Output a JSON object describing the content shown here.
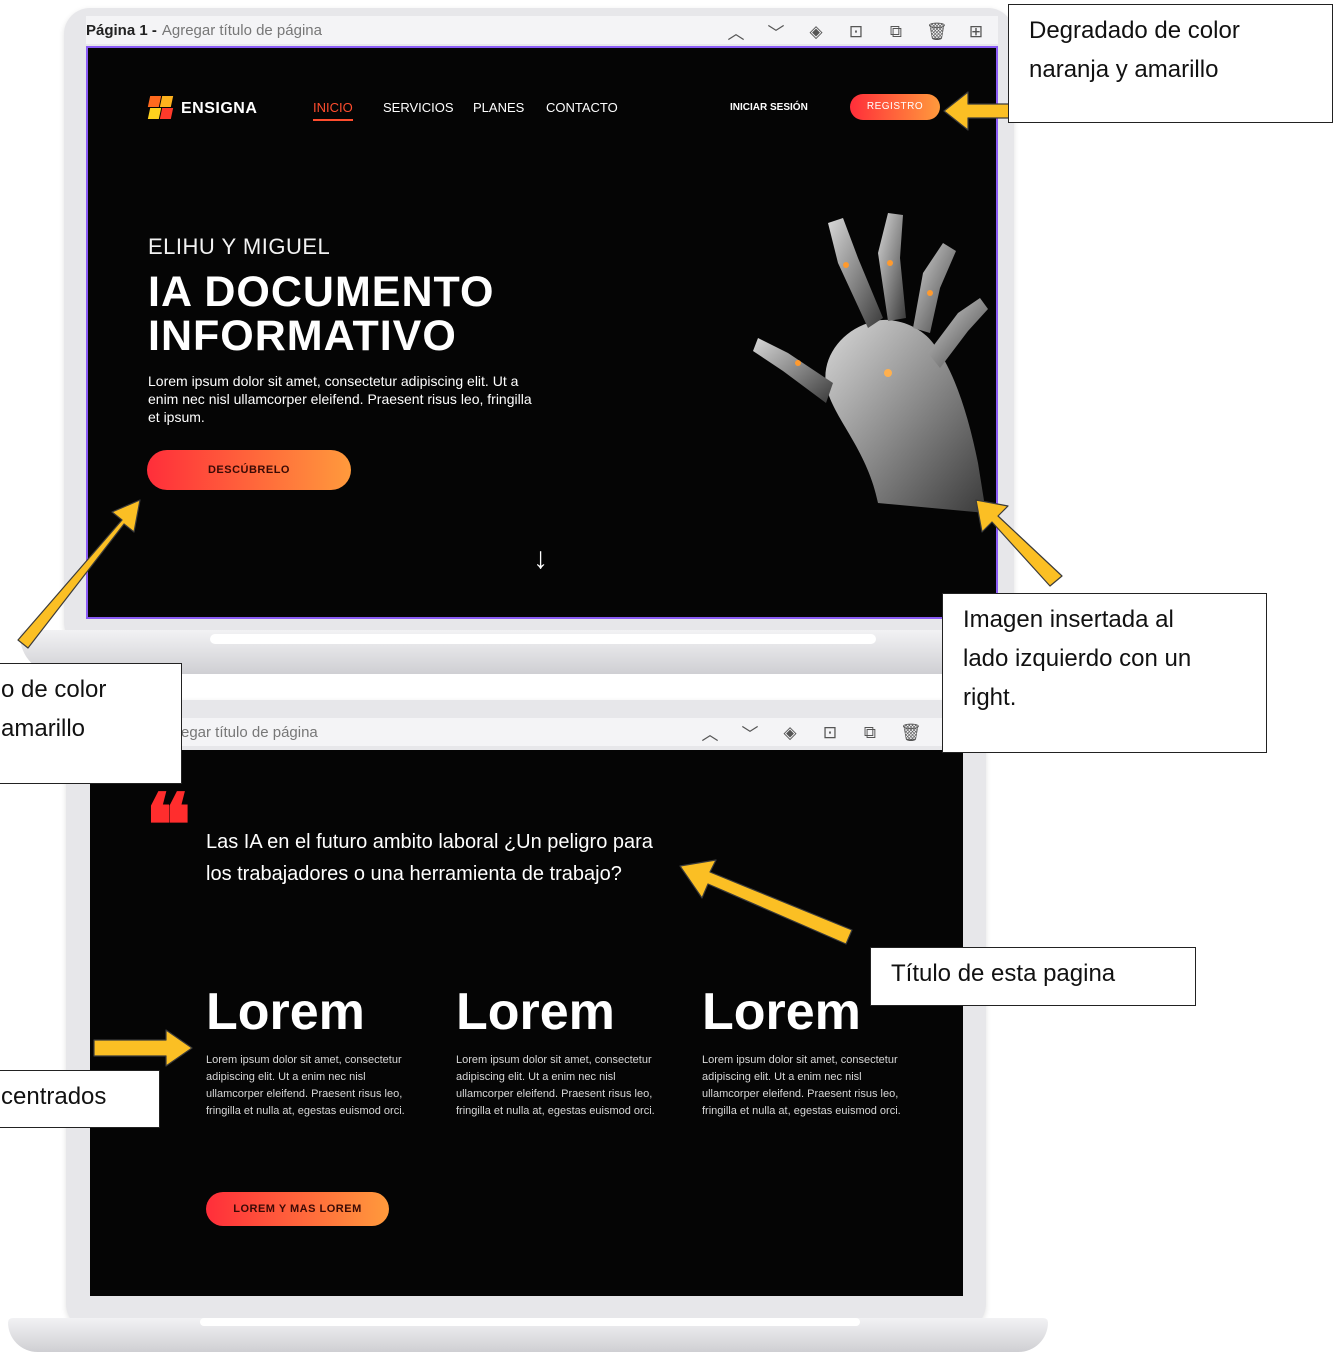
{
  "page1": {
    "toolbar": {
      "page_number": "Página 1 -",
      "title_placeholder": "Agregar título de página"
    },
    "logo": {
      "text": "ENSIGNA"
    },
    "nav": [
      "INICIO",
      "SERVICIOS",
      "PLANES",
      "CONTACTO"
    ],
    "login_label": "INICIAR SESIÓN",
    "register_label": "REGISTRO",
    "hero": {
      "kicker": "ELIHU Y MIGUEL",
      "headline_line1": "IA DOCUMENTO",
      "headline_line2": "INFORMATIVO",
      "lead": "Lorem ipsum dolor sit amet, consectetur adipiscing elit. Ut a enim nec nisl ullamcorper eleifend. Praesent risus leo, fringilla et ipsum.",
      "cta_label": "DESCÚBRELO",
      "down_arrow": "↓"
    }
  },
  "page2": {
    "toolbar": {
      "title_placeholder": "regar título de página"
    },
    "quote_mark": "❝",
    "title": "Las IA en el futuro ambito laboral ¿Un peligro para los trabajadores o una herramienta de trabajo?",
    "columns": [
      {
        "heading": "Lorem",
        "text": "Lorem ipsum dolor sit amet, consectetur adipiscing elit. Ut a enim nec nisl ullamcorper eleifend. Praesent risus leo, fringilla et nulla at, egestas euismod orci."
      },
      {
        "heading": "Lorem",
        "text": "Lorem ipsum dolor sit amet, consectetur adipiscing elit. Ut a enim nec nisl ullamcorper eleifend. Praesent risus leo, fringilla et nulla at, egestas euismod orci."
      },
      {
        "heading": "Lorem",
        "text": "Lorem ipsum dolor sit amet, consectetur adipiscing elit. Ut a enim nec nisl ullamcorper eleifend. Praesent risus leo, fringilla et nulla at, egestas euismod orci."
      }
    ],
    "cta_label": "LOREM Y MAS LOREM"
  },
  "toolbar_icons": [
    "chevron-up-icon",
    "chevron-down-icon",
    "eye-off-icon",
    "lock-icon",
    "duplicate-icon",
    "trash-icon",
    "add-page-icon"
  ],
  "toolbar_glyphs": [
    "︿",
    "﹀",
    "◈",
    "⊡",
    "⧉",
    "🗑",
    "⊞"
  ],
  "callouts": {
    "top_right": {
      "line1": "Degradado de color",
      "line2": "naranja y amarillo"
    },
    "left_middle": {
      "line1": "o de color",
      "line2": "amarillo"
    },
    "right_image": {
      "line1": "Imagen insertada al",
      "line2": "lado izquierdo con un",
      "line3": "right."
    },
    "page_title": {
      "text": "Título de esta pagina"
    },
    "left_bottom": {
      "text": "centrados"
    }
  },
  "colors": {
    "accent_start": "#ff2e3a",
    "accent_end": "#ff9a3c",
    "arrow": "#fbbf24",
    "selection": "#8b5cf6",
    "background": "#050505"
  }
}
